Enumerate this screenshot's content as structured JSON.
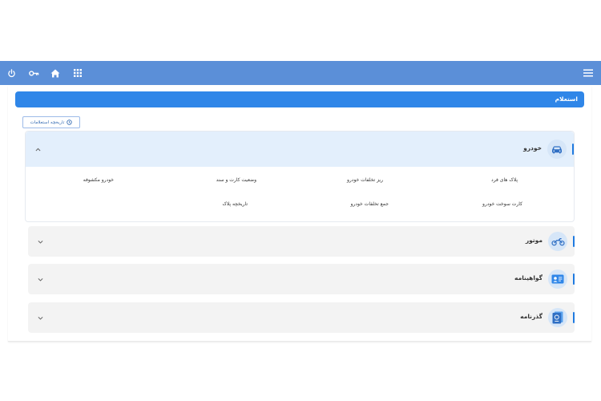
{
  "toolbar": {
    "icons": [
      "power-icon",
      "key-icon",
      "home-icon",
      "apps-grid-icon",
      "menu-icon"
    ]
  },
  "header": {
    "title": "استعلام"
  },
  "history_button": {
    "label": "تاریخچه استعلامات"
  },
  "panels": [
    {
      "title": "خودرو",
      "expanded": true,
      "items": [
        "پلاک های فرد",
        "ریز تخلفات خودرو",
        "وضعیت کارت و سند",
        "خودرو مکشوفه",
        "کارت سوخت خودرو",
        "جمع تخلفات خودرو",
        "تاریخچه پلاک"
      ]
    },
    {
      "title": "موتور",
      "expanded": false
    },
    {
      "title": "گواهینامه",
      "expanded": false
    },
    {
      "title": "گذرنامه",
      "expanded": false
    }
  ],
  "colors": {
    "topbar": "#5b8fd8",
    "header": "#2f86e8",
    "accent": "#1f7ae0",
    "expanded_panel": "#e3effc",
    "collapsed_panel": "#f3f3f3"
  }
}
